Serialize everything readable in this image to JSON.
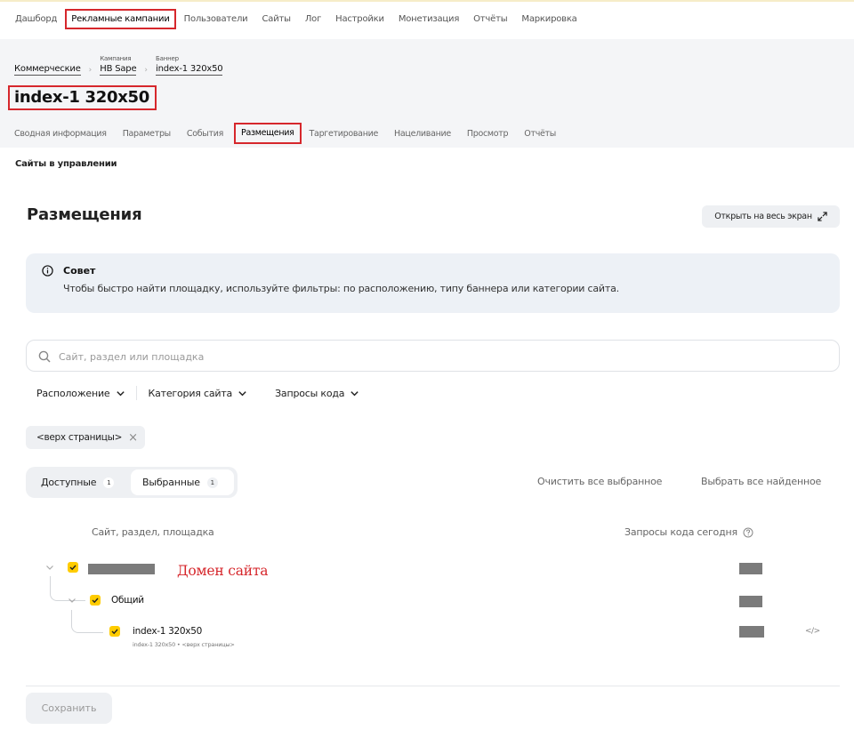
{
  "topnav": {
    "items": [
      "Дашборд",
      "Рекламные кампании",
      "Пользователи",
      "Сайты",
      "Лог",
      "Настройки",
      "Монетизация",
      "Отчёты",
      "Маркировка"
    ],
    "active_index": 1
  },
  "breadcrumbs": {
    "root": "Коммерческие",
    "campaign_caption": "Кампания",
    "campaign": "HB Sape",
    "banner_caption": "Баннер",
    "banner": "index-1 320x50"
  },
  "page_title": "index-1 320x50",
  "subnav": {
    "items": [
      "Сводная информация",
      "Параметры",
      "События",
      "Размещения",
      "Таргетирование",
      "Нацеливание",
      "Просмотр",
      "Отчёты"
    ],
    "active_index": 3
  },
  "section_label": "Сайты в управлении",
  "placements": {
    "title": "Размещения",
    "fullscreen_label": "Открыть на весь экран",
    "tip": {
      "title": "Совет",
      "text": "Чтобы быстро найти площадку, используйте фильтры: по расположению, типу баннера или категории сайта."
    },
    "search": {
      "placeholder": "Сайт, раздел или площадка",
      "value": ""
    },
    "filters": [
      "Расположение",
      "Категория сайта",
      "Запросы кода"
    ],
    "chip": "<верх страницы>",
    "segments": [
      {
        "label": "Доступные",
        "count": "1",
        "selected": false
      },
      {
        "label": "Выбранные",
        "count": "1",
        "selected": true
      }
    ],
    "actions": {
      "clear": "Очистить все выбранное",
      "select_all": "Выбрать все найденное"
    },
    "columns": {
      "name": "Сайт, раздел, площадка",
      "requests": "Запросы кода сегодня"
    },
    "tree": {
      "domain_annotation": "Домен сайта",
      "section_label": "Общий",
      "placement_label": "index-1 320x50",
      "placement_sub": "index-1 320x50 • <верх страницы>",
      "code_icon": "</>"
    },
    "save_label": "Сохранить"
  },
  "colors": {
    "accent_yellow": "#ffcc00",
    "highlight_red": "#d6272c",
    "header_bg": "#f4f5f7",
    "tip_bg": "#edf1f6"
  }
}
